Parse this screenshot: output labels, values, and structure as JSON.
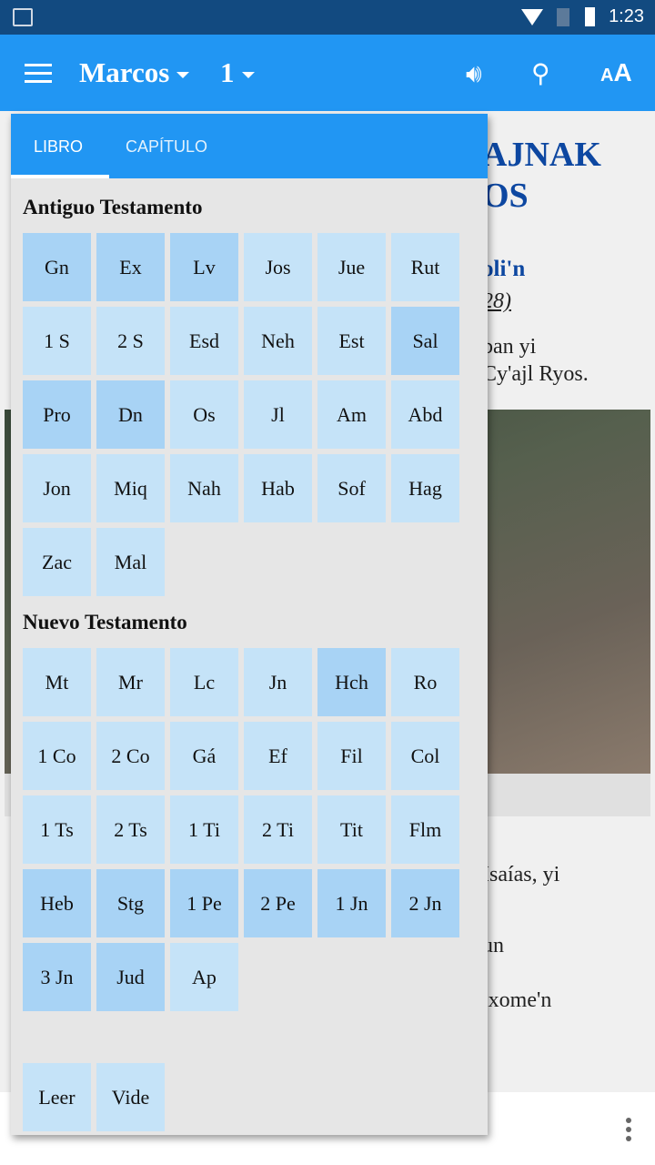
{
  "status": {
    "time": "1:23"
  },
  "appbar": {
    "book": "Marcos",
    "chapter": "1",
    "icons": [
      "menu-icon",
      "volume-icon",
      "search-icon",
      "text-size-icon"
    ]
  },
  "background": {
    "title_lines": [
      "AJNAK",
      "OS"
    ],
    "subtitle": "oli'n",
    "ref": "28)",
    "lines": [
      "ban yi",
      "Cy'ajl Ryos.",
      "Isaías, yi",
      "un",
      "ixome'n"
    ]
  },
  "panel": {
    "tabs": [
      "LIBRO",
      "CAPÍTULO"
    ],
    "old_title": "Antiguo Testamento",
    "new_title": "Nuevo Testamento",
    "old": [
      {
        "l": "Gn",
        "d": 1
      },
      {
        "l": "Ex",
        "d": 1
      },
      {
        "l": "Lv",
        "d": 1
      },
      {
        "l": "Jos"
      },
      {
        "l": "Jue"
      },
      {
        "l": "Rut"
      },
      {
        "l": "1 S"
      },
      {
        "l": "2 S"
      },
      {
        "l": "Esd"
      },
      {
        "l": "Neh"
      },
      {
        "l": "Est"
      },
      {
        "l": "Sal",
        "d": 1
      },
      {
        "l": "Pro",
        "d": 1
      },
      {
        "l": "Dn",
        "d": 1
      },
      {
        "l": "Os"
      },
      {
        "l": "Jl"
      },
      {
        "l": "Am"
      },
      {
        "l": "Abd"
      },
      {
        "l": "Jon"
      },
      {
        "l": "Miq"
      },
      {
        "l": "Nah"
      },
      {
        "l": "Hab"
      },
      {
        "l": "Sof"
      },
      {
        "l": "Hag"
      },
      {
        "l": "Zac"
      },
      {
        "l": "Mal"
      }
    ],
    "new": [
      {
        "l": "Mt"
      },
      {
        "l": "Mr"
      },
      {
        "l": "Lc"
      },
      {
        "l": "Jn"
      },
      {
        "l": "Hch",
        "d": 1
      },
      {
        "l": "Ro"
      },
      {
        "l": "1 Co"
      },
      {
        "l": "2 Co"
      },
      {
        "l": "Gá"
      },
      {
        "l": "Ef"
      },
      {
        "l": "Fil"
      },
      {
        "l": "Col"
      },
      {
        "l": "1 Ts"
      },
      {
        "l": "2 Ts"
      },
      {
        "l": "1 Ti"
      },
      {
        "l": "2 Ti"
      },
      {
        "l": "Tit"
      },
      {
        "l": "Flm"
      },
      {
        "l": "Heb",
        "d": 1
      },
      {
        "l": "Stg",
        "d": 1
      },
      {
        "l": "1 Pe",
        "d": 1
      },
      {
        "l": "2 Pe",
        "d": 1
      },
      {
        "l": "1 Jn",
        "d": 1
      },
      {
        "l": "2 Jn",
        "d": 1
      },
      {
        "l": "3 Jn",
        "d": 1
      },
      {
        "l": "Jud",
        "d": 1
      },
      {
        "l": "Ap"
      }
    ],
    "extra": [
      {
        "l": "Leer"
      },
      {
        "l": "Vide"
      }
    ]
  },
  "colors": {
    "primary": "#2196f3",
    "status": "#124a80",
    "tile": "#c5e3f8",
    "tile_dark": "#a8d3f5"
  }
}
